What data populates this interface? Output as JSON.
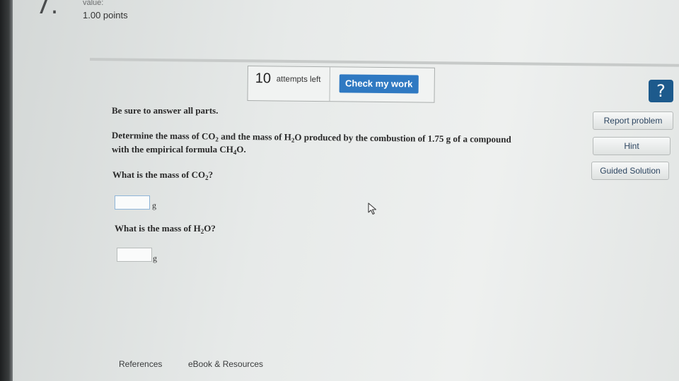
{
  "question": {
    "number": "7.",
    "value_label": "value:",
    "points": "1.00 points"
  },
  "attempts": {
    "count": "10",
    "label": "attempts left",
    "check_button": "Check my work"
  },
  "sidebar": {
    "help_symbol": "?",
    "report_problem": "Report problem",
    "hint": "Hint",
    "guided_solution": "Guided Solution"
  },
  "problem": {
    "instructions": "Be sure to answer all parts.",
    "line1": {
      "a": "Determine the mass of CO",
      "a_sub": "2",
      "b": " and the mass of H",
      "b_sub": "2",
      "c": "O produced by the combustion of 1.75 g of a compound"
    },
    "line2": {
      "a": "with the empirical formula CH",
      "a_sub": "4",
      "b": "O."
    }
  },
  "parts": [
    {
      "prefix": "What is the mass of CO",
      "sub": "2",
      "suffix": "?",
      "value": "",
      "unit": "g"
    },
    {
      "prefix": "What is the mass of H",
      "sub": "2",
      "suffix": "O?",
      "value": "",
      "unit": "g"
    }
  ],
  "footer": {
    "references": "References",
    "ebook": "eBook & Resources"
  },
  "colors": {
    "primary_button": "#2f79c2",
    "help_icon": "#1d5a8c",
    "background": "#e7eae9"
  },
  "icons": [
    "help-icon",
    "mouse-cursor-icon"
  ]
}
